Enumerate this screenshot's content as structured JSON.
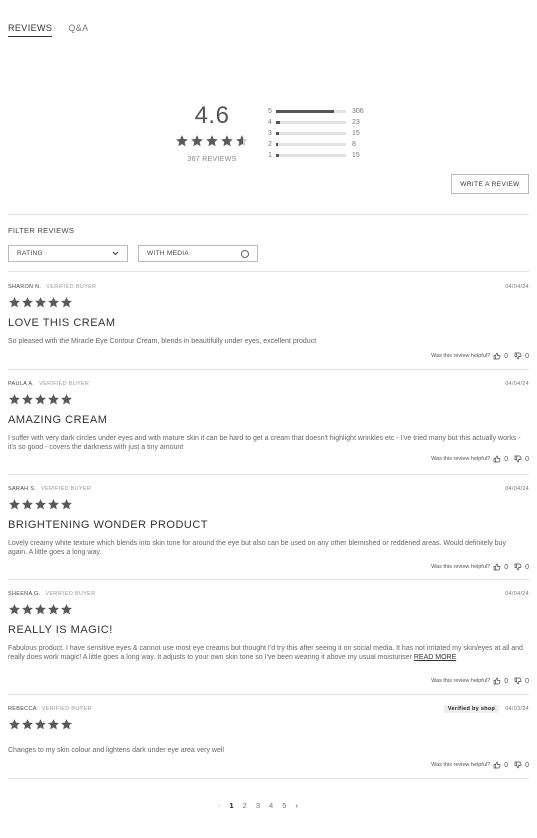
{
  "tabs": [
    {
      "label": "REVIEWS",
      "active": true
    },
    {
      "label": "Q&A",
      "active": false
    }
  ],
  "summary": {
    "average": "4.6",
    "average_value": 4.6,
    "count_label": "367 REVIEWS"
  },
  "distribution": [
    {
      "stars": "5",
      "count": "306",
      "fraction": 0.834
    },
    {
      "stars": "4",
      "count": "23",
      "fraction": 0.063
    },
    {
      "stars": "3",
      "count": "15",
      "fraction": 0.041
    },
    {
      "stars": "2",
      "count": "8",
      "fraction": 0.022
    },
    {
      "stars": "1",
      "count": "15",
      "fraction": 0.041
    }
  ],
  "write_review_label": "WRITE A REVIEW",
  "filter": {
    "title": "FILTER REVIEWS",
    "rating_label": "RATING",
    "media_label": "WITH MEDIA"
  },
  "helpful_label": "Was this review helpful?",
  "reviews": [
    {
      "name": "SHARON N.",
      "badge": "VERIFIED BUYER",
      "date": "04/04/24",
      "rating": 5,
      "title": "LOVE THIS CREAM",
      "body": "So pleased with the Miracle Eye Contour Cream, blends in beautifully under eyes, excellent product",
      "up": "0",
      "down": "0"
    },
    {
      "name": "PAULA A.",
      "badge": "VERIFIED BUYER",
      "date": "04/04/24",
      "rating": 5,
      "title": "AMAZING CREAM",
      "body": "I suffer with very dark circles under eyes and with mature skin it can be hard to get a cream that doesn't highlight wrinkles etc - I've tried many but this actually works - it's so good - covers the darkness with just a tiny amount",
      "up": "0",
      "down": "0"
    },
    {
      "name": "SARAH S.",
      "badge": "VERIFIED BUYER",
      "date": "04/04/24",
      "rating": 5,
      "title": "BRIGHTENING WONDER PRODUCT",
      "body": "Lovely creamy white texture which blends into skin tone for around the eye but also can be used on any other blemished or reddened areas. Would definitely buy again. A little goes a long way.",
      "up": "0",
      "down": "0"
    },
    {
      "name": "SHEENA G.",
      "badge": "VERIFIED BUYER",
      "date": "04/04/24",
      "rating": 5,
      "title": "REALLY IS MAGIC!",
      "body": "Fabulous product. I have sensitive eyes & cannot use most eye creams but thought I'd try this after seeing it on social media. It has not irritated my skin/eyes at all and really does work magic! A little goes a long way. It adjusts to your own skin tone so I've been wearing it above my usual moisturiser",
      "read_more": "READ MORE",
      "up": "0",
      "down": "0"
    },
    {
      "name": "REBECCA",
      "badge": "VERIFIED BUYER",
      "shop_badge": "Verified by shop",
      "date": "04/03/24",
      "rating": 5,
      "title": "",
      "body": "Changes to my skin colour and lightens dark under eye area very well",
      "up": "0",
      "down": "0"
    }
  ],
  "pagination": {
    "pages": [
      "1",
      "2",
      "3",
      "4",
      "5"
    ],
    "current": "1"
  },
  "colors": {
    "star": "#5a5a5a",
    "star_empty": "#cccccc",
    "bar_fill": "#555555",
    "bar_bg": "#e2e2e2"
  },
  "icons": {
    "prev": "chevron-left-icon",
    "next": "chevron-right-icon",
    "helpful_up": "thumbs-up-icon",
    "helpful_down": "thumbs-down-icon",
    "dropdown": "chevron-down-icon"
  }
}
